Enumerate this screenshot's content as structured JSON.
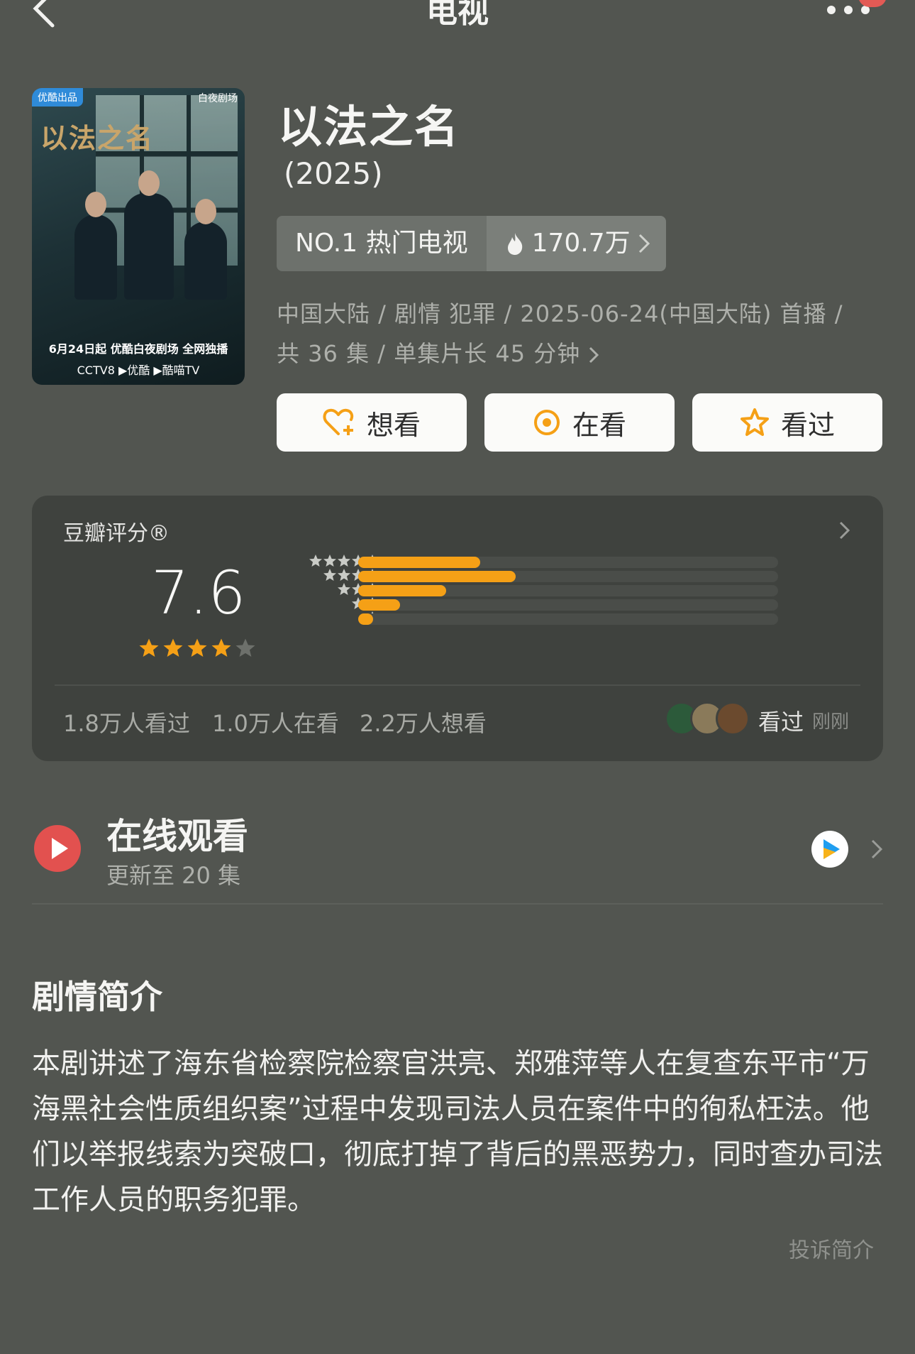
{
  "nav": {
    "title": "电视"
  },
  "poster": {
    "badge": "优酷出品",
    "brand": "白夜剧场",
    "title_text": "以法之名",
    "date_line": "6月24日起 优酷白夜剧场 全网独播",
    "logos_line": "CCTV8 ▶优酷 ▶酷喵TV"
  },
  "show": {
    "title": "以法之名",
    "year": "(2025)",
    "rank": "NO.1 热门电视",
    "heat": "170.7万",
    "info": "中国大陆 / 剧情 犯罪 / 2025-06-24(中国大陆) 首播 / 共 36 集 / 单集片长 45 分钟"
  },
  "actions": {
    "want": "想看",
    "watching": "在看",
    "watched": "看过"
  },
  "rating": {
    "label": "豆瓣评分®",
    "score": "7.6",
    "stars": 4,
    "distribution": [
      {
        "stars": 5,
        "fraction": 0.29
      },
      {
        "stars": 4,
        "fraction": 0.375
      },
      {
        "stars": 3,
        "fraction": 0.21
      },
      {
        "stars": 2,
        "fraction": 0.1
      },
      {
        "stars": 1,
        "fraction": 0.035
      }
    ],
    "watched_count": "1.8万人看过",
    "watching_count": "1.0万人在看",
    "want_count": "2.2万人想看",
    "friend_action": "看过",
    "friend_time": "刚刚"
  },
  "online": {
    "title": "在线观看",
    "subtitle": "更新至 20 集"
  },
  "synopsis": {
    "title": "剧情简介",
    "text": "本剧讲述了海东省检察院检察官洪亮、郑雅萍等人在复查东平市“万海黑社会性质组织案”过程中发现司法人员在案件中的徇私枉法。他们以举报线索为突破口，彻底打掉了背后的黑恶势力，同时查办司法工作人员的职务犯罪。",
    "report": "投诉简介"
  },
  "colors": {
    "background": "#525550",
    "accent_orange": "#f5a016",
    "red": "#e2514f"
  }
}
